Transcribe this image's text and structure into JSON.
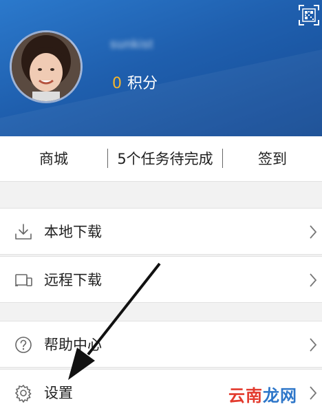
{
  "profile": {
    "username": "sunkist",
    "points_value": "0",
    "points_label": "积分"
  },
  "quickbar": {
    "mall": "商城",
    "tasks": "5个任务待完成",
    "checkin": "签到"
  },
  "menu": {
    "local_download": "本地下载",
    "remote_download": "远程下载",
    "help_center": "帮助中心",
    "settings": "设置"
  },
  "watermark": {
    "part1": "云南",
    "part2": "龙网"
  },
  "colors": {
    "header_blue": "#1f5fae",
    "points_accent": "#f6b62c",
    "watermark_red": "#e33b2e"
  },
  "icons": {
    "qr": "qr-code-icon",
    "download": "download-icon",
    "remote": "remote-devices-icon",
    "help": "help-circle-icon",
    "settings": "gear-icon",
    "chevron": "chevron-right-icon"
  }
}
